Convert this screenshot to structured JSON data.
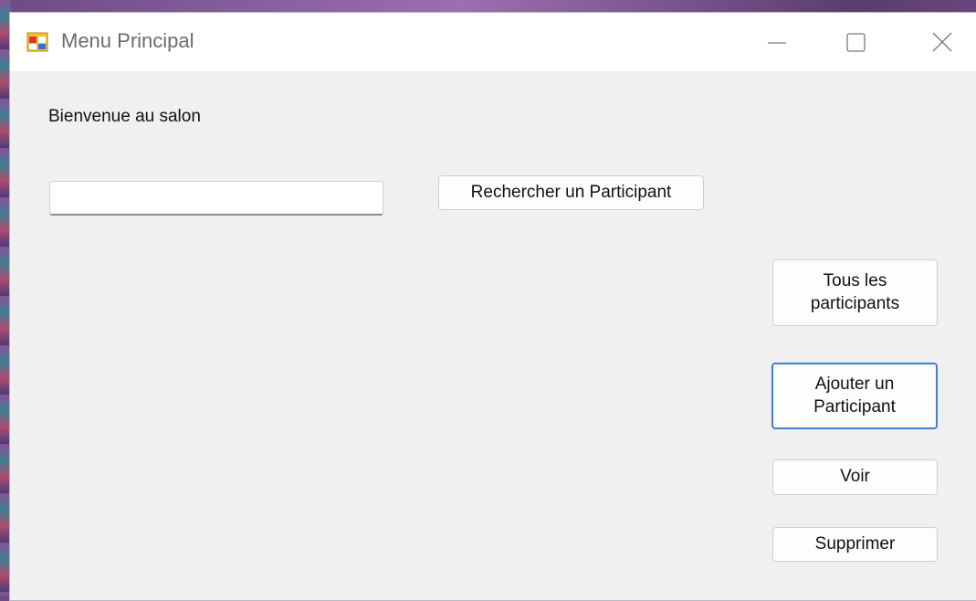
{
  "window": {
    "title": "Menu Principal",
    "controls": {
      "minimize": "—",
      "maximize": "☐",
      "close": "✕"
    }
  },
  "main": {
    "welcome_label": "Bienvenue au salon",
    "search_input": {
      "value": "",
      "placeholder": ""
    },
    "search_button": "Rechercher un Participant",
    "all_participants_button": "Tous les participants",
    "add_participant_button": "Ajouter un Participant",
    "view_button": "Voir",
    "delete_button": "Supprimer"
  },
  "icons": {
    "app_icon": "windows-form-icon",
    "minimize": "minimize-icon",
    "maximize": "maximize-icon",
    "close": "close-icon"
  },
  "colors": {
    "window_bg": "#f0f0f0",
    "titlebar_bg": "#ffffff",
    "focus_border": "#3b82d6"
  }
}
